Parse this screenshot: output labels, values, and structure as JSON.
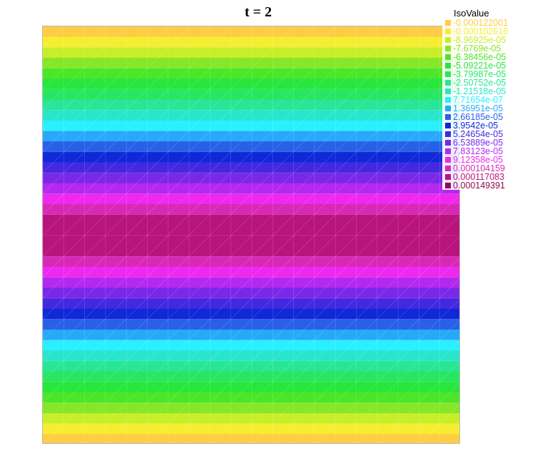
{
  "chart_data": {
    "type": "heatmap",
    "title": "t = 2",
    "legend_title": "IsoValue",
    "legend_position": "top-right",
    "iso_levels": [
      {
        "label": "-0.000122001",
        "color": "#ffcc44"
      },
      {
        "label": "-0.000102616",
        "color": "#f5ee30"
      },
      {
        "label": "-8.96925e-05",
        "color": "#c8ee28"
      },
      {
        "label": "-7.6769e-05",
        "color": "#86e628"
      },
      {
        "label": "-6.38456e-05",
        "color": "#4ce628"
      },
      {
        "label": "-5.09221e-05",
        "color": "#28e63c"
      },
      {
        "label": "-3.79987e-05",
        "color": "#28e660"
      },
      {
        "label": "-2.50752e-05",
        "color": "#28e696"
      },
      {
        "label": "-1.21518e-05",
        "color": "#28e6cc"
      },
      {
        "label": "7.71654e-07",
        "color": "#28f0ff"
      },
      {
        "label": "1.36951e-05",
        "color": "#28a8f8"
      },
      {
        "label": "2.66185e-05",
        "color": "#2860e8"
      },
      {
        "label": "3.9542e-05",
        "color": "#1028d8"
      },
      {
        "label": "5.24654e-05",
        "color": "#4428e0"
      },
      {
        "label": "6.53889e-05",
        "color": "#7a28e8"
      },
      {
        "label": "7.83123e-05",
        "color": "#b428f0"
      },
      {
        "label": "9.12358e-05",
        "color": "#ee28ee"
      },
      {
        "label": "0.000104159",
        "color": "#d828b8"
      },
      {
        "label": "0.000117083",
        "color": "#b8147c"
      },
      {
        "label": "0.000149391",
        "color": "#8c0c54"
      }
    ],
    "field_bands_level_index": [
      0,
      1,
      2,
      3,
      4,
      5,
      6,
      7,
      8,
      9,
      10,
      11,
      12,
      13,
      14,
      15,
      16,
      17,
      18,
      18,
      18,
      18,
      17,
      16,
      15,
      14,
      13,
      12,
      11,
      10,
      9,
      8,
      7,
      6,
      5,
      4,
      3,
      2,
      1,
      0
    ],
    "mesh_grid": true
  }
}
